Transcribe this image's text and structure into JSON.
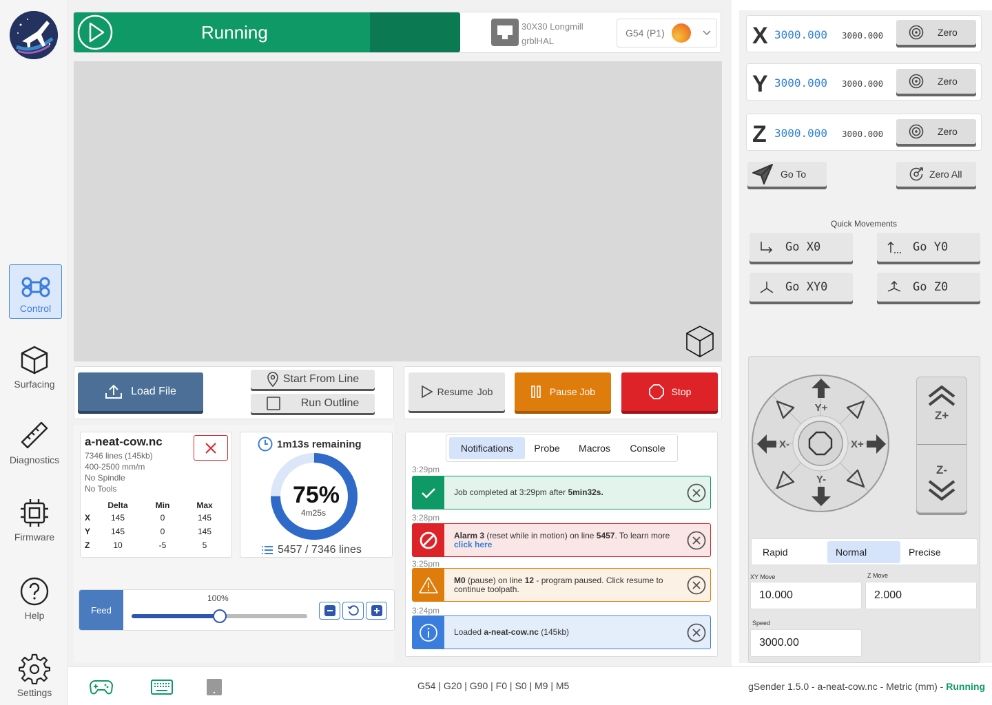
{
  "status": {
    "label": "Running"
  },
  "machine": {
    "name": "30X30 Longmill",
    "firmware": "grblHAL"
  },
  "workspace": {
    "selected": "G54 (P1)"
  },
  "nav": {
    "control": "Control",
    "surfacing": "Surfacing",
    "diagnostics": "Diagnostics",
    "firmware": "Firmware",
    "help": "Help",
    "settings": "Settings"
  },
  "file_controls": {
    "load": "Load File",
    "start_from_line": "Start From Line",
    "run_outline": "Run Outline"
  },
  "job_controls": {
    "resume": "Resume",
    "resume_suffix": "Job",
    "pause": "Pause Job",
    "stop": "Stop"
  },
  "file_info": {
    "name": "a-neat-cow.nc",
    "lines": "7346 lines (145kb)",
    "feed_range": "400-2500 mm/m",
    "spindle": "No Spindle",
    "tools": "No Tools",
    "headers": [
      "Delta",
      "Min",
      "Max"
    ],
    "rows": [
      {
        "axis": "X",
        "delta": "145",
        "min": "0",
        "max": "145"
      },
      {
        "axis": "Y",
        "delta": "145",
        "min": "0",
        "max": "145"
      },
      {
        "axis": "Z",
        "delta": "10",
        "min": "-5",
        "max": "5"
      }
    ]
  },
  "progress": {
    "remaining": "1m13s remaining",
    "percent_label": "75%",
    "percent": 0.75,
    "elapsed": "4m25s",
    "lines": "5457 / 7346 lines"
  },
  "feed_override": {
    "label": "Feed",
    "value_label": "100%",
    "slider_fraction": 0.5
  },
  "tabs": [
    "Notifications",
    "Probe",
    "Macros",
    "Console"
  ],
  "notifications": [
    {
      "time": "3:29pm",
      "pre": "Job completed at 3:29pm after ",
      "bold": "5min32s.",
      "post": ""
    },
    {
      "time": "3:28pm",
      "bold1": "Alarm 3",
      "mid": " (reset while in motion) on line ",
      "bold2": "5457",
      "post": ".  To learn more ",
      "link": "click here"
    },
    {
      "time": "3:25pm",
      "bold1": "M0",
      "mid": " (pause) on line ",
      "bold2": "12",
      "post": " - program paused.  Click resume to continue toolpath."
    },
    {
      "time": "3:24pm",
      "pre": "Loaded ",
      "bold": "a-neat-cow.nc",
      "post": " (145kb)"
    }
  ],
  "dro": {
    "x": {
      "axis": "X",
      "work": "3000.000",
      "machine": "3000.000",
      "zero": "Zero"
    },
    "y": {
      "axis": "Y",
      "work": "3000.000",
      "machine": "3000.000",
      "zero": "Zero"
    },
    "z": {
      "axis": "Z",
      "work": "3000.000",
      "machine": "3000.000",
      "zero": "Zero"
    }
  },
  "goto": "Go To",
  "zero_all": "Zero All",
  "quick": {
    "title": "Quick Movements",
    "x0": "Go X0",
    "y0": "Go Y0",
    "xy0": "Go XY0",
    "z0": "Go Z0"
  },
  "jog": {
    "yplus": "Y+",
    "yminus": "Y-",
    "xplus": "X+",
    "xminus": "X-",
    "zplus": "Z+",
    "zminus": "Z-"
  },
  "jog_modes": [
    "Rapid",
    "Normal",
    "Precise"
  ],
  "jog_mode_selected": "Normal",
  "jog_inputs": {
    "xy_label": "XY Move",
    "xy_value": "10.000",
    "z_label": "Z Move",
    "z_value": "2.000",
    "speed_label": "Speed",
    "speed_value": "3000.00"
  },
  "footer": {
    "gcodes": [
      "G54",
      "G20",
      "G90",
      "F0",
      "S0",
      "M9",
      "M5"
    ],
    "app_info": "gSender 1.5.0 - a-neat-cow.nc - Metric (mm) - ",
    "state": "Running"
  },
  "colors": {
    "accent_green": "#0e9966",
    "pause_orange": "#de7c0c",
    "stop_red": "#dd2328",
    "load_blue": "#4b6f97",
    "dro_blue": "#2f7fd6"
  }
}
